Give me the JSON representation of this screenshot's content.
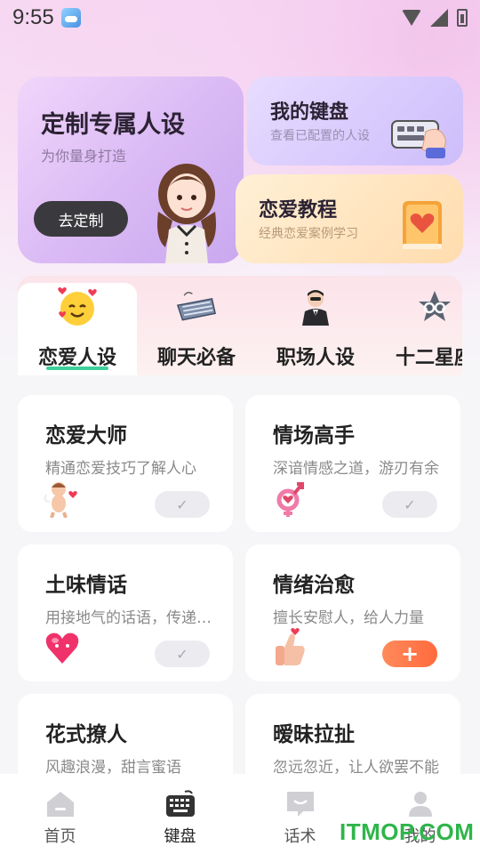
{
  "status_bar": {
    "time": "9:55",
    "weather_icon": "weather-cloud-icon",
    "icons": [
      "wifi-icon",
      "signal-icon",
      "battery-icon"
    ]
  },
  "hero": {
    "title": "定制专属人设",
    "subtitle": "为你量身打造",
    "button": "去定制"
  },
  "my_keyboard": {
    "title": "我的键盘",
    "subtitle": "查看已配置的人设"
  },
  "love_tutorial": {
    "title": "恋爱教程",
    "subtitle": "经典恋爱案例学习"
  },
  "tabs": [
    {
      "label": "恋爱人设",
      "icon": "smiling-face-with-hearts-icon",
      "active": true
    },
    {
      "label": "聊天必备",
      "icon": "keyboard-icon",
      "active": false
    },
    {
      "label": "职场人设",
      "icon": "businessman-icon",
      "active": false
    },
    {
      "label": "十二星座",
      "icon": "zodiac-icon",
      "active": false
    }
  ],
  "personas": [
    {
      "title": "恋爱大师",
      "desc": "精通恋爱技巧了解人心",
      "icon": "cupid-icon",
      "action": "check"
    },
    {
      "title": "情场高手",
      "desc": "深谙情感之道，游刃有余",
      "icon": "gender-hearts-icon",
      "action": "check"
    },
    {
      "title": "土味情话",
      "desc": "用接地气的话语，传递爱意",
      "icon": "heart-icon",
      "action": "check"
    },
    {
      "title": "情绪治愈",
      "desc": "擅长安慰人，给人力量",
      "icon": "thumbs-up-icon",
      "action": "add"
    },
    {
      "title": "花式撩人",
      "desc": "风趣浪漫，甜言蜜语",
      "icon": "",
      "action": ""
    },
    {
      "title": "暧昧拉扯",
      "desc": "忽远忽近，让人欲罢不能",
      "icon": "",
      "action": ""
    }
  ],
  "bottom_nav": [
    {
      "label": "首页",
      "icon": "home-icon"
    },
    {
      "label": "键盘",
      "icon": "keyboard-icon"
    },
    {
      "label": "话术",
      "icon": "chat-icon"
    },
    {
      "label": "我的",
      "icon": "user-icon"
    }
  ],
  "watermark": "ITMOP.COM",
  "colors": {
    "accent": "#ff6a3d",
    "tab_underline": "#3fcf9a",
    "dark_button": "#3a3a3e"
  }
}
